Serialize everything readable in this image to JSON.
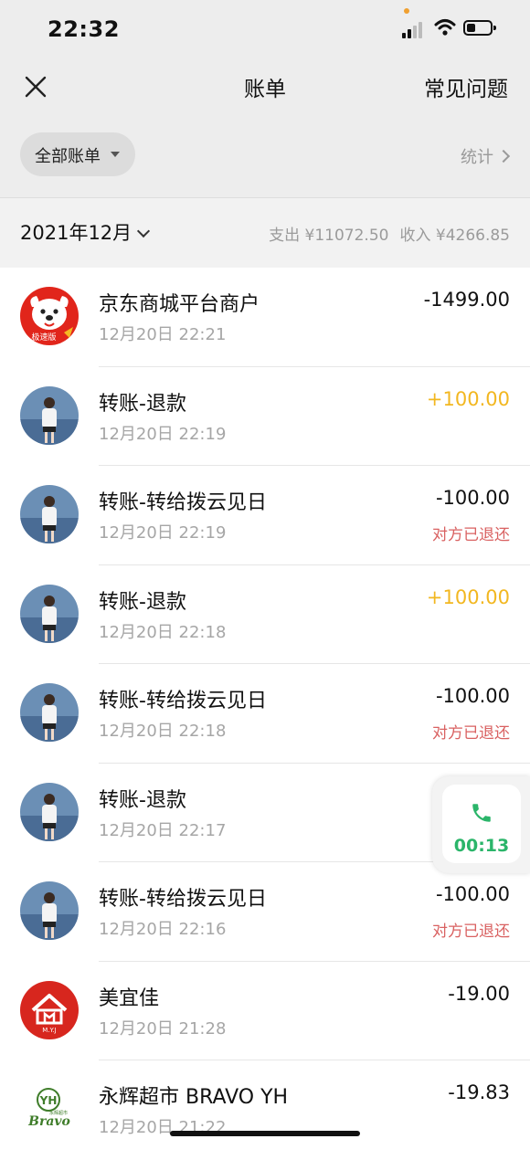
{
  "status_bar": {
    "time": "22:32"
  },
  "nav": {
    "title": "账单",
    "faq_label": "常见问题"
  },
  "filter": {
    "label": "全部账单",
    "stats_label": "统计"
  },
  "month": {
    "label": "2021年12月",
    "expense": "支出 ¥11072.50",
    "income": "收入 ¥4266.85"
  },
  "transactions": [
    {
      "title": "京东商城平台商户",
      "date": "12月20日 22:21",
      "amount": "-1499.00",
      "note": "",
      "avatar": "jd-logo-icon",
      "positive": false
    },
    {
      "title": "转账-退款",
      "date": "12月20日 22:19",
      "amount": "+100.00",
      "note": "",
      "avatar": "user-photo-avatar",
      "positive": true
    },
    {
      "title": "转账-转给拨云见日",
      "date": "12月20日 22:19",
      "amount": "-100.00",
      "note": "对方已退还",
      "avatar": "user-photo-avatar",
      "positive": false
    },
    {
      "title": "转账-退款",
      "date": "12月20日 22:18",
      "amount": "+100.00",
      "note": "",
      "avatar": "user-photo-avatar",
      "positive": true
    },
    {
      "title": "转账-转给拨云见日",
      "date": "12月20日 22:18",
      "amount": "-100.00",
      "note": "对方已退还",
      "avatar": "user-photo-avatar",
      "positive": false
    },
    {
      "title": "转账-退款",
      "date": "12月20日 22:17",
      "amount": "",
      "note": "",
      "avatar": "user-photo-avatar",
      "positive": true
    },
    {
      "title": "转账-转给拨云见日",
      "date": "12月20日 22:16",
      "amount": "-100.00",
      "note": "对方已退还",
      "avatar": "user-photo-avatar",
      "positive": false
    },
    {
      "title": "美宜佳",
      "date": "12月20日 21:28",
      "amount": "-19.00",
      "note": "",
      "avatar": "meiyijia-logo-icon",
      "positive": false
    },
    {
      "title": "永辉超市 BRAVO YH",
      "date": "12月20日 21:22",
      "amount": "-19.83",
      "note": "",
      "avatar": "yonghui-logo-icon",
      "positive": false
    }
  ],
  "call_widget": {
    "duration": "00:13",
    "icon": "phone-icon"
  },
  "colors": {
    "income": "#f2b720",
    "refund_note": "#d96161",
    "call_green": "#2bb56a",
    "header_bg": "#ededed"
  },
  "logos": {
    "jd_badge": "极速版",
    "meiyijia": "M.Y.J",
    "yonghui_mark": "YH",
    "yonghui_brand": "Bravo",
    "yonghui_sub": "永辉超市"
  }
}
